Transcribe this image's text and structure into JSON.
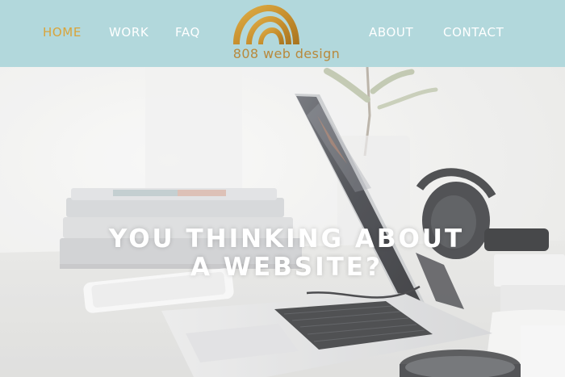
{
  "nav": {
    "home": "HOME",
    "work": "WORK",
    "faq": "FAQ",
    "about": "ABOUT",
    "contact": "CONTACT",
    "active": "home"
  },
  "brand": {
    "name": "808 web design",
    "color": "#b8893c"
  },
  "colors": {
    "header_bg": "#b2d8dc",
    "nav_text": "#ffffff",
    "nav_active": "#d9a43a"
  },
  "hero": {
    "title_line1": "YOU THINKING ABOUT",
    "title_line2": "A WEBSITE?",
    "image_description_icon": "laptop-desk-photo"
  }
}
